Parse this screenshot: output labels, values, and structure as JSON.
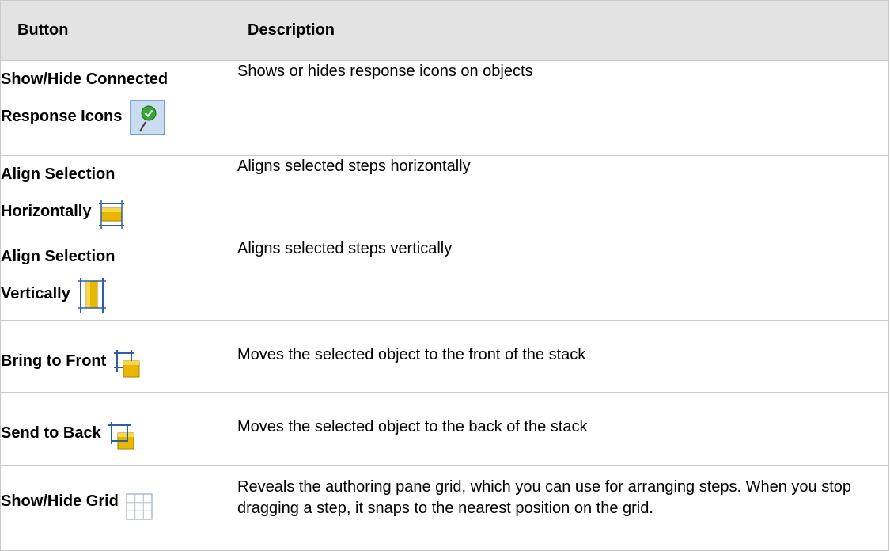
{
  "table": {
    "headers": {
      "button": "Button",
      "description": "Description"
    },
    "rows": [
      {
        "button_line1": "Show/Hide Connected",
        "button_line2": "Response Icons",
        "icon": "response-icon",
        "description": "Shows or hides response icons on objects"
      },
      {
        "button_line1": "Align Selection",
        "button_line2": "Horizontally",
        "icon": "align-horizontal-icon",
        "description": "Aligns selected steps horizontally"
      },
      {
        "button_line1": "Align Selection",
        "button_line2": "Vertically",
        "icon": "align-vertical-icon",
        "description": "Aligns selected steps vertically"
      },
      {
        "button_line1": "Bring to Front",
        "button_line2": "",
        "icon": "bring-to-front-icon",
        "description": "Moves the selected object to the front of the stack"
      },
      {
        "button_line1": "Send to Back",
        "button_line2": "",
        "icon": "send-to-back-icon",
        "description": "Moves the selected object to the back of the stack"
      },
      {
        "button_line1": "Show/Hide Grid",
        "button_line2": "",
        "icon": "grid-icon",
        "description": "Reveals the authoring pane grid, which you can use for arranging steps. When you stop dragging a step, it snaps to the nearest position on the grid."
      }
    ]
  },
  "colors": {
    "header_bg": "#e3e3e3",
    "border": "#c8c8c8",
    "icon_gold": "#e8b800",
    "icon_blue": "#2f5f9f"
  }
}
